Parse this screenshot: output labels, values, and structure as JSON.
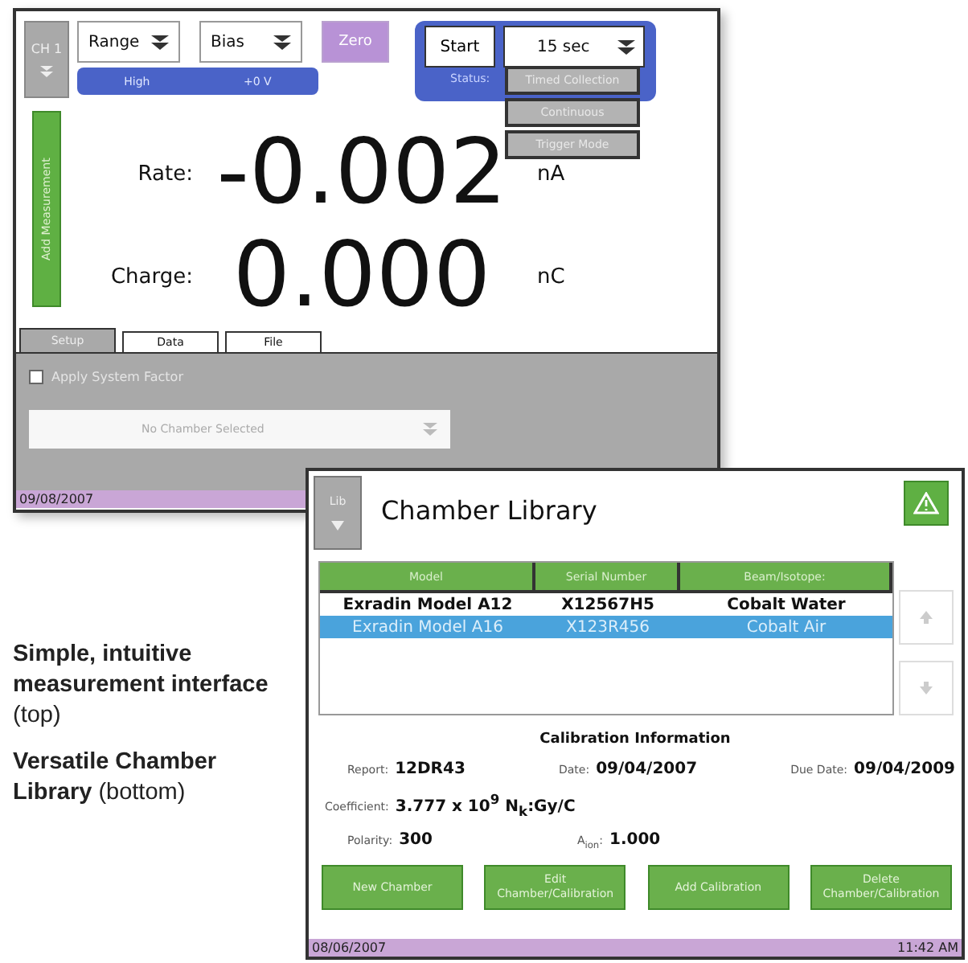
{
  "measurement_window": {
    "channel_button": "CH 1",
    "range_dropdown": "Range",
    "bias_dropdown": "Bias",
    "zero_button": {
      "label": "Zero",
      "disabled": true
    },
    "range_value": "High",
    "bias_value": "+0 V",
    "start_button": "Start",
    "duration_dropdown": "15 sec",
    "status_label": "Status:",
    "mode_menu": [
      {
        "label": "Timed Collection"
      },
      {
        "label": "Continuous"
      },
      {
        "label": "Trigger Mode"
      }
    ],
    "add_measurement_button": "Add Measurement",
    "readings": [
      {
        "label": "Rate:",
        "value": "-0.002",
        "unit": "nA"
      },
      {
        "label": "Charge:",
        "value": "0.000",
        "unit": "nC"
      }
    ],
    "tabs": [
      {
        "label": "Setup",
        "selected": true
      },
      {
        "label": "Data",
        "selected": false
      },
      {
        "label": "File",
        "selected": false
      }
    ],
    "apply_system_factor": {
      "label": "Apply System Factor",
      "checked": false
    },
    "chamber_dropdown": "No Chamber Selected",
    "status_bar": {
      "date": "09/08/2007"
    }
  },
  "library_window": {
    "library_button": "Lib",
    "title": "Chamber Library",
    "table": {
      "columns": [
        "Model",
        "Serial Number",
        "Beam/Isotope:"
      ],
      "rows": [
        {
          "cells": [
            "Exradin Model A12",
            "X12567H5",
            "Cobalt Water"
          ],
          "selected": false
        },
        {
          "cells": [
            "Exradin Model A16",
            "X123R456",
            "Cobalt Air"
          ],
          "selected": true
        }
      ]
    },
    "calibration": {
      "title": "Calibration Information",
      "rows": [
        [
          {
            "label": "Report:",
            "value": "12DR43"
          },
          {
            "label": "Date:",
            "value": "09/04/2007"
          },
          {
            "label": "Due Date:",
            "value": "09/04/2009"
          }
        ],
        [
          {
            "label": "Coefficient:",
            "value": "3.777 x 10$^{9}$ N$_{k}$:Gy/C"
          }
        ],
        [
          {
            "label": "Polarity:",
            "value": "300"
          },
          {
            "label": "A$_{ion}$:",
            "value": "1.000"
          }
        ]
      ]
    },
    "buttons": [
      "New Chamber",
      "Edit Chamber/Calibration",
      "Add Calibration",
      "Delete Chamber/Calibration"
    ],
    "status_bar": {
      "date": "08/06/2007",
      "time": "11:42 AM"
    }
  },
  "captions": [
    "**Simple, intuitive measurement interface** (top)",
    "**Versatile Chamber Library** (bottom)"
  ]
}
